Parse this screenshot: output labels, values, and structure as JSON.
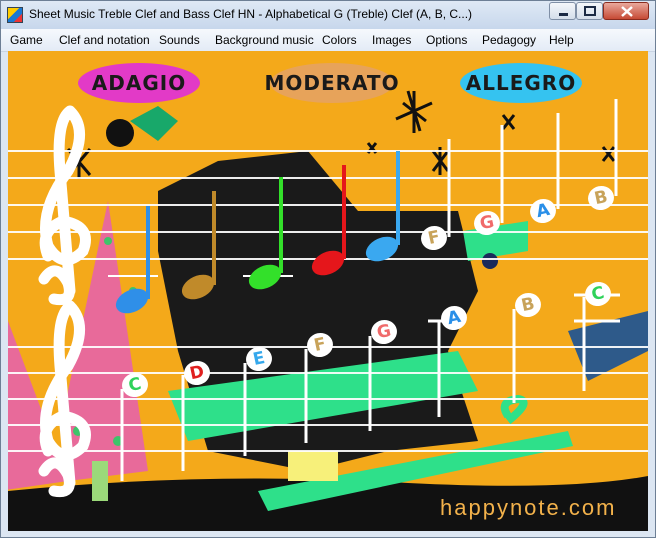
{
  "window": {
    "title": "Sheet Music Treble Clef and Bass Clef HN - Alphabetical G (Treble) Clef (A, B, C...)",
    "icons": {
      "app": "app-icon",
      "minimize": "minimize-icon",
      "maximize": "maximize-icon",
      "close": "close-icon"
    }
  },
  "menu": [
    {
      "name": "menu-game",
      "label": "Game"
    },
    {
      "name": "menu-clef",
      "label": "Clef and notation"
    },
    {
      "name": "menu-sounds",
      "label": "Sounds"
    },
    {
      "name": "menu-background-music",
      "label": "Background music"
    },
    {
      "name": "menu-colors",
      "label": "Colors"
    },
    {
      "name": "menu-images",
      "label": "Images"
    },
    {
      "name": "menu-options",
      "label": "Options"
    },
    {
      "name": "menu-pedagogy",
      "label": "Pedagogy"
    },
    {
      "name": "menu-help",
      "label": "Help"
    }
  ],
  "tempo": {
    "adagio": "ADAGIO",
    "moderato": "MODERATO",
    "allegro": "ALLEGRO"
  },
  "upper_labels": [
    {
      "letter": "F",
      "color": "#c8a35a"
    },
    {
      "letter": "G",
      "color": "#f06a6a"
    },
    {
      "letter": "A",
      "color": "#2a8fe8"
    },
    {
      "letter": "B",
      "color": "#c8a35a"
    }
  ],
  "lower_labels": [
    {
      "letter": "C",
      "color": "#2fd25a"
    },
    {
      "letter": "D",
      "color": "#e0201f"
    },
    {
      "letter": "E",
      "color": "#35a8ec"
    },
    {
      "letter": "F",
      "color": "#c8a35a"
    },
    {
      "letter": "G",
      "color": "#f06a6a"
    },
    {
      "letter": "A",
      "color": "#2a8fe8"
    },
    {
      "letter": "B",
      "color": "#c8a35a"
    },
    {
      "letter": "C",
      "color": "#2fd25a"
    }
  ],
  "note_colors": {
    "upper_notes": [
      "#2f8fe8",
      "#c08a2a",
      "#33e02a",
      "#e5161b",
      "#3aa8f0"
    ]
  },
  "watermark": "happynote.com"
}
